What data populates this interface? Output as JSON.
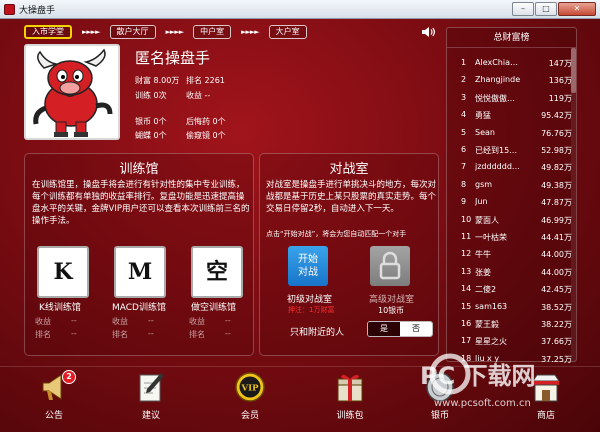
{
  "window": {
    "title": "大操盘手"
  },
  "nav": {
    "steps": [
      "入市学堂",
      "散户大厅",
      "中户室",
      "大户室"
    ],
    "arrows": "►►►►"
  },
  "profile": {
    "name": "匿名操盘手",
    "wealth_label": "财富 8.00万",
    "rank_label": "排名 2261",
    "training_label": "训练 0次",
    "income_label": "收益 --",
    "coins_label": "银币 0个",
    "regret_label": "后悔药 0个",
    "butterfly_label": "蝴蝶 0个",
    "telescope_label": "偷窥镜 0个"
  },
  "training": {
    "title": "训练馆",
    "description": "在训练馆里，操盘手将会进行有针对性的集中专业训练，每个训练都有单独的收益率排行。复盘功能是迅速提高操盘水平的关键，金牌VIP用户还可以查看本次训练前三名的操作手法。",
    "items": [
      {
        "glyph": "K",
        "name": "K线训练馆",
        "income_label": "收益",
        "income_value": "--",
        "rank_label": "排名",
        "rank_value": "--"
      },
      {
        "glyph": "M",
        "name": "MACD训练馆",
        "income_label": "收益",
        "income_value": "--",
        "rank_label": "排名",
        "rank_value": "--"
      },
      {
        "glyph": "空",
        "name": "做空训练馆",
        "income_label": "收益",
        "income_value": "--",
        "rank_label": "排名",
        "rank_value": "--"
      }
    ]
  },
  "battle": {
    "title": "对战室",
    "description": "对战室是操盘手进行单挑决斗的地方，每次对战都是基于历史上某只股票的真实走势。每个交易日停留2秒，自动进入下一天。",
    "hint": "点击“开始对战”，将会为您自动匹配一个对手",
    "start_line1": "开始",
    "start_line2": "对战",
    "junior_name": "初级对战室",
    "junior_note": "押注：1万财富",
    "senior_name": "高级对战室",
    "senior_note": "10银币",
    "nearby_label": "只和附近的人",
    "yes_label": "是",
    "no_label": "否"
  },
  "ranking": {
    "title": "总财富榜",
    "rows": [
      {
        "n": "1",
        "name": "AlexChia…",
        "value": "147万"
      },
      {
        "n": "2",
        "name": "Zhangjinde",
        "value": "136万"
      },
      {
        "n": "3",
        "name": "悦悦傲傲…",
        "value": "119万"
      },
      {
        "n": "4",
        "name": "勇猛",
        "value": "95.42万"
      },
      {
        "n": "5",
        "name": "Sean",
        "value": "76.76万"
      },
      {
        "n": "6",
        "name": "已经到15…",
        "value": "52.98万"
      },
      {
        "n": "7",
        "name": "jzdddddd…",
        "value": "49.82万"
      },
      {
        "n": "8",
        "name": "gsm",
        "value": "49.38万"
      },
      {
        "n": "9",
        "name": "Jun",
        "value": "47.87万"
      },
      {
        "n": "10",
        "name": "蒙面人",
        "value": "46.99万"
      },
      {
        "n": "11",
        "name": "一叶枯荣",
        "value": "44.41万"
      },
      {
        "n": "12",
        "name": "牛牛",
        "value": "44.00万"
      },
      {
        "n": "13",
        "name": "张姜",
        "value": "44.00万"
      },
      {
        "n": "14",
        "name": "二傻2",
        "value": "42.45万"
      },
      {
        "n": "15",
        "name": "sam163",
        "value": "38.52万"
      },
      {
        "n": "16",
        "name": "蒙王毅",
        "value": "38.22万"
      },
      {
        "n": "17",
        "name": "星星之火",
        "value": "37.66万"
      },
      {
        "n": "18",
        "name": "liu x y",
        "value": "37.25万"
      }
    ]
  },
  "bottom": {
    "items": [
      {
        "label": "公告",
        "badge": "2"
      },
      {
        "label": "建议"
      },
      {
        "label": "会员",
        "icon_text": "VIP"
      },
      {
        "label": "训练包"
      },
      {
        "label": "银币"
      },
      {
        "label": "商店"
      }
    ]
  },
  "watermark": {
    "big": "PC 下载网",
    "url": "www.pcsoft.com.cn"
  },
  "colors": {
    "accent_yellow": "#f2d200",
    "start_blue": "#1874c9",
    "bet_red": "#ff3030",
    "bg_red": "#7a0c12"
  }
}
